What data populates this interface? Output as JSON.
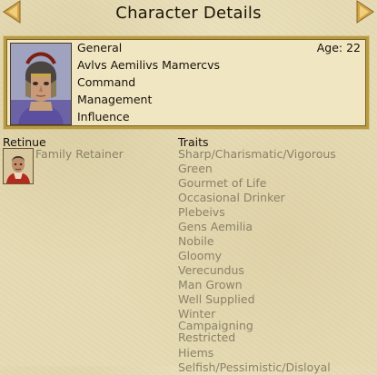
{
  "header": {
    "title": "Character Details",
    "prev_icon": "arrow-left-icon",
    "next_icon": "arrow-right-icon",
    "arrow_color": "#d3a54a"
  },
  "character": {
    "rank": "General",
    "age_label": "Age: 22",
    "name": "Avlvs Aemilivs Mamercvs",
    "stat_1": "Command",
    "stat_2": "Management",
    "stat_3": "Influence",
    "portrait_icon": "general-portrait"
  },
  "retinue": {
    "heading": "Retinue",
    "items": [
      {
        "name": "Family Retainer",
        "icon": "retainer-portrait"
      }
    ]
  },
  "traits": {
    "heading": "Traits",
    "items": [
      "Sharp/Charismatic/Vigorous",
      "Green",
      "Gourmet of Life",
      "Occasional Drinker",
      "Plebeivs",
      "Gens Aemilia",
      "Nobile",
      "Gloomy",
      "Verecundus",
      "Man Grown",
      "Well Supplied",
      "Winter Campaigning Restricted",
      "Hiems",
      "Selfish/Pessimistic/Disloyal"
    ]
  },
  "colors": {
    "panel_border": "#b79a45",
    "trait_text": "#8a8168",
    "main_text": "#16110a"
  }
}
